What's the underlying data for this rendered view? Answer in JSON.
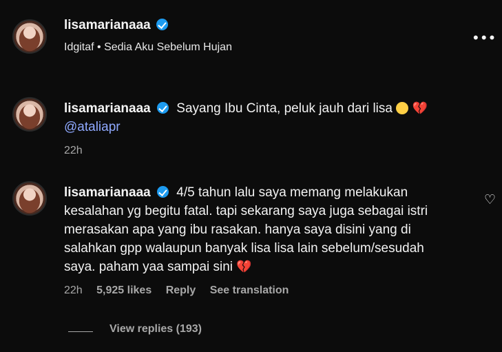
{
  "post": {
    "username": "lisamarianaaa",
    "subtitle": "Idgitaf • Sedia Aku Sebelum Hujan",
    "more_icon": "more-dots-icon"
  },
  "comments": [
    {
      "username": "lisamarianaaa",
      "text": "Sayang Ibu Cinta, peluk jauh dari lisa",
      "mention": "@ataliapr",
      "time": "22h"
    },
    {
      "username": "lisamarianaaa",
      "text_lines": [
        "4/5 tahun lalu saya memang melakukan",
        "kesalahan yg begitu fatal. tapi sekarang saya juga sebagai istri",
        "merasakan apa yang ibu rasakan. hanya saya disini yang di",
        "salahkan gpp walaupun banyak lisa lisa lain sebelum/sesudah",
        "saya. paham yaa sampai sini"
      ],
      "time": "22h",
      "likes": "5,925 likes",
      "reply": "Reply",
      "translate": "See translation"
    }
  ],
  "replies": {
    "label": "View replies (193)"
  },
  "colors": {
    "background": "#0c0c0c",
    "verified": "#1d9bf0",
    "mention": "#8fa9ff",
    "secondary_text": "#a8a8a8"
  }
}
